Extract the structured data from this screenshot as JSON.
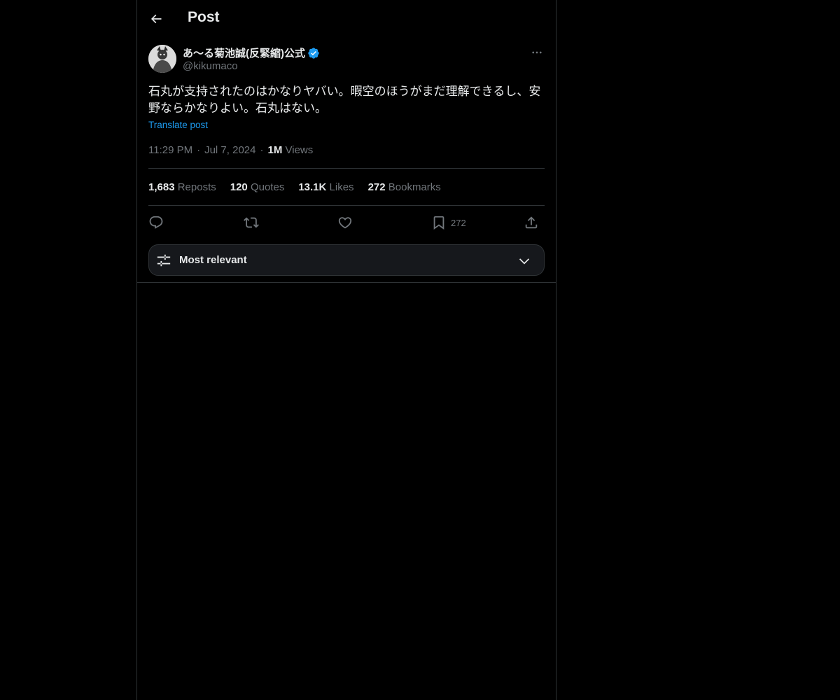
{
  "header": {
    "title": "Post"
  },
  "author": {
    "display_name": "あ〜る菊池誠(反緊縮)公式",
    "handle": "@kikumaco",
    "verified": true
  },
  "post": {
    "text": "石丸が支持されたのはかなりヤバい。暇空のほうがまだ理解できるし、安野ならかなりよい。石丸はない。",
    "translate_label": "Translate post",
    "time": "11:29 PM",
    "date": "Jul 7, 2024",
    "views_count": "1M",
    "views_label": "Views"
  },
  "stats": [
    {
      "count": "1,683",
      "label": "Reposts"
    },
    {
      "count": "120",
      "label": "Quotes"
    },
    {
      "count": "13.1K",
      "label": "Likes"
    },
    {
      "count": "272",
      "label": "Bookmarks"
    }
  ],
  "actions": {
    "bookmark_count": "272"
  },
  "replies_sort": {
    "label": "Most relevant"
  },
  "colors": {
    "accent": "#1d9bf0",
    "background": "#000000",
    "muted": "#71767b",
    "border": "#2f3336"
  }
}
